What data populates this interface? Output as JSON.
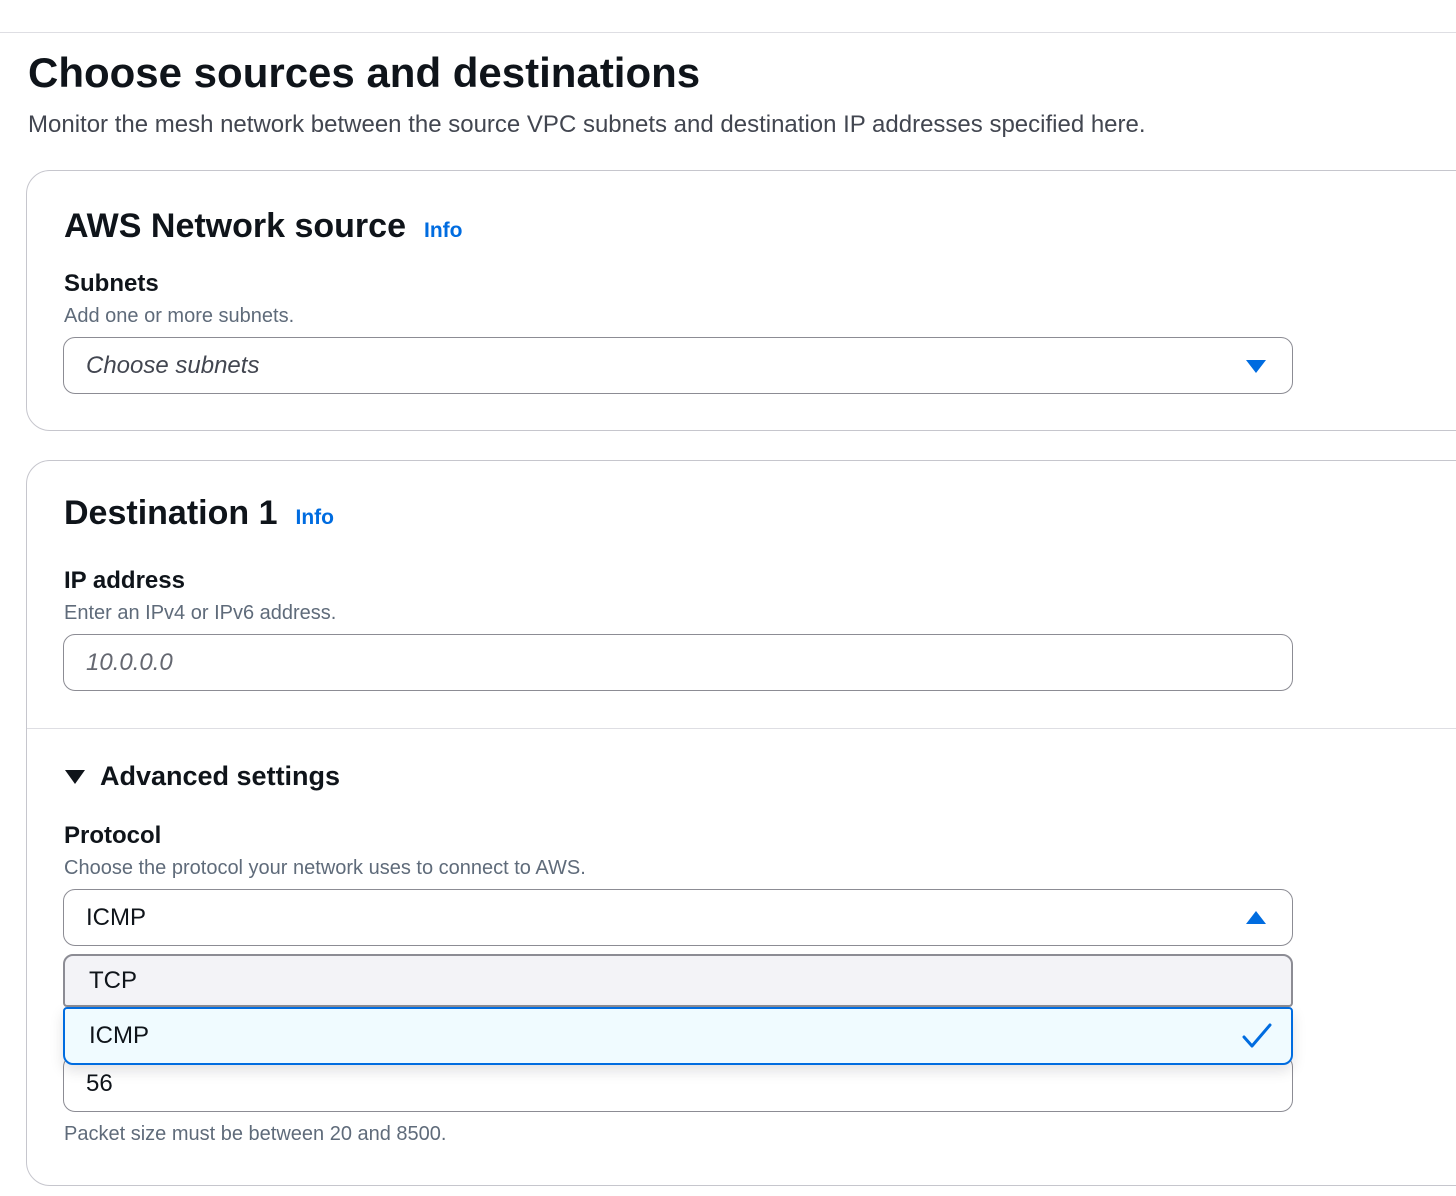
{
  "page": {
    "title": "Choose sources and destinations",
    "description": "Monitor the mesh network between the source VPC subnets and destination IP addresses specified here."
  },
  "source": {
    "title": "AWS Network source",
    "info_label": "Info",
    "subnets": {
      "label": "Subnets",
      "description": "Add one or more subnets.",
      "placeholder": "Choose subnets"
    }
  },
  "destination": {
    "title": "Destination 1",
    "info_label": "Info",
    "ip_address": {
      "label": "IP address",
      "description": "Enter an IPv4 or IPv6 address.",
      "placeholder": "10.0.0.0",
      "value": ""
    },
    "advanced": {
      "label": "Advanced settings",
      "expanded": true,
      "protocol": {
        "label": "Protocol",
        "description": "Choose the protocol your network uses to connect to AWS.",
        "selected": "ICMP",
        "options": [
          "TCP",
          "ICMP"
        ]
      },
      "packet_size": {
        "value": "56",
        "hint": "Packet size must be between 20 and 8500."
      }
    }
  },
  "colors": {
    "link": "#006ce0",
    "selected_option_bg": "#f0fbff",
    "hover_option_bg": "#f3f3f7",
    "text_primary": "#0f141a",
    "text_secondary": "#5f6b7a"
  },
  "icons": {
    "subnets_dropdown": "caret-down-icon",
    "protocol_dropdown": "caret-up-icon",
    "expander": "caret-down-filled-icon",
    "selected_option": "checkmark-icon"
  }
}
